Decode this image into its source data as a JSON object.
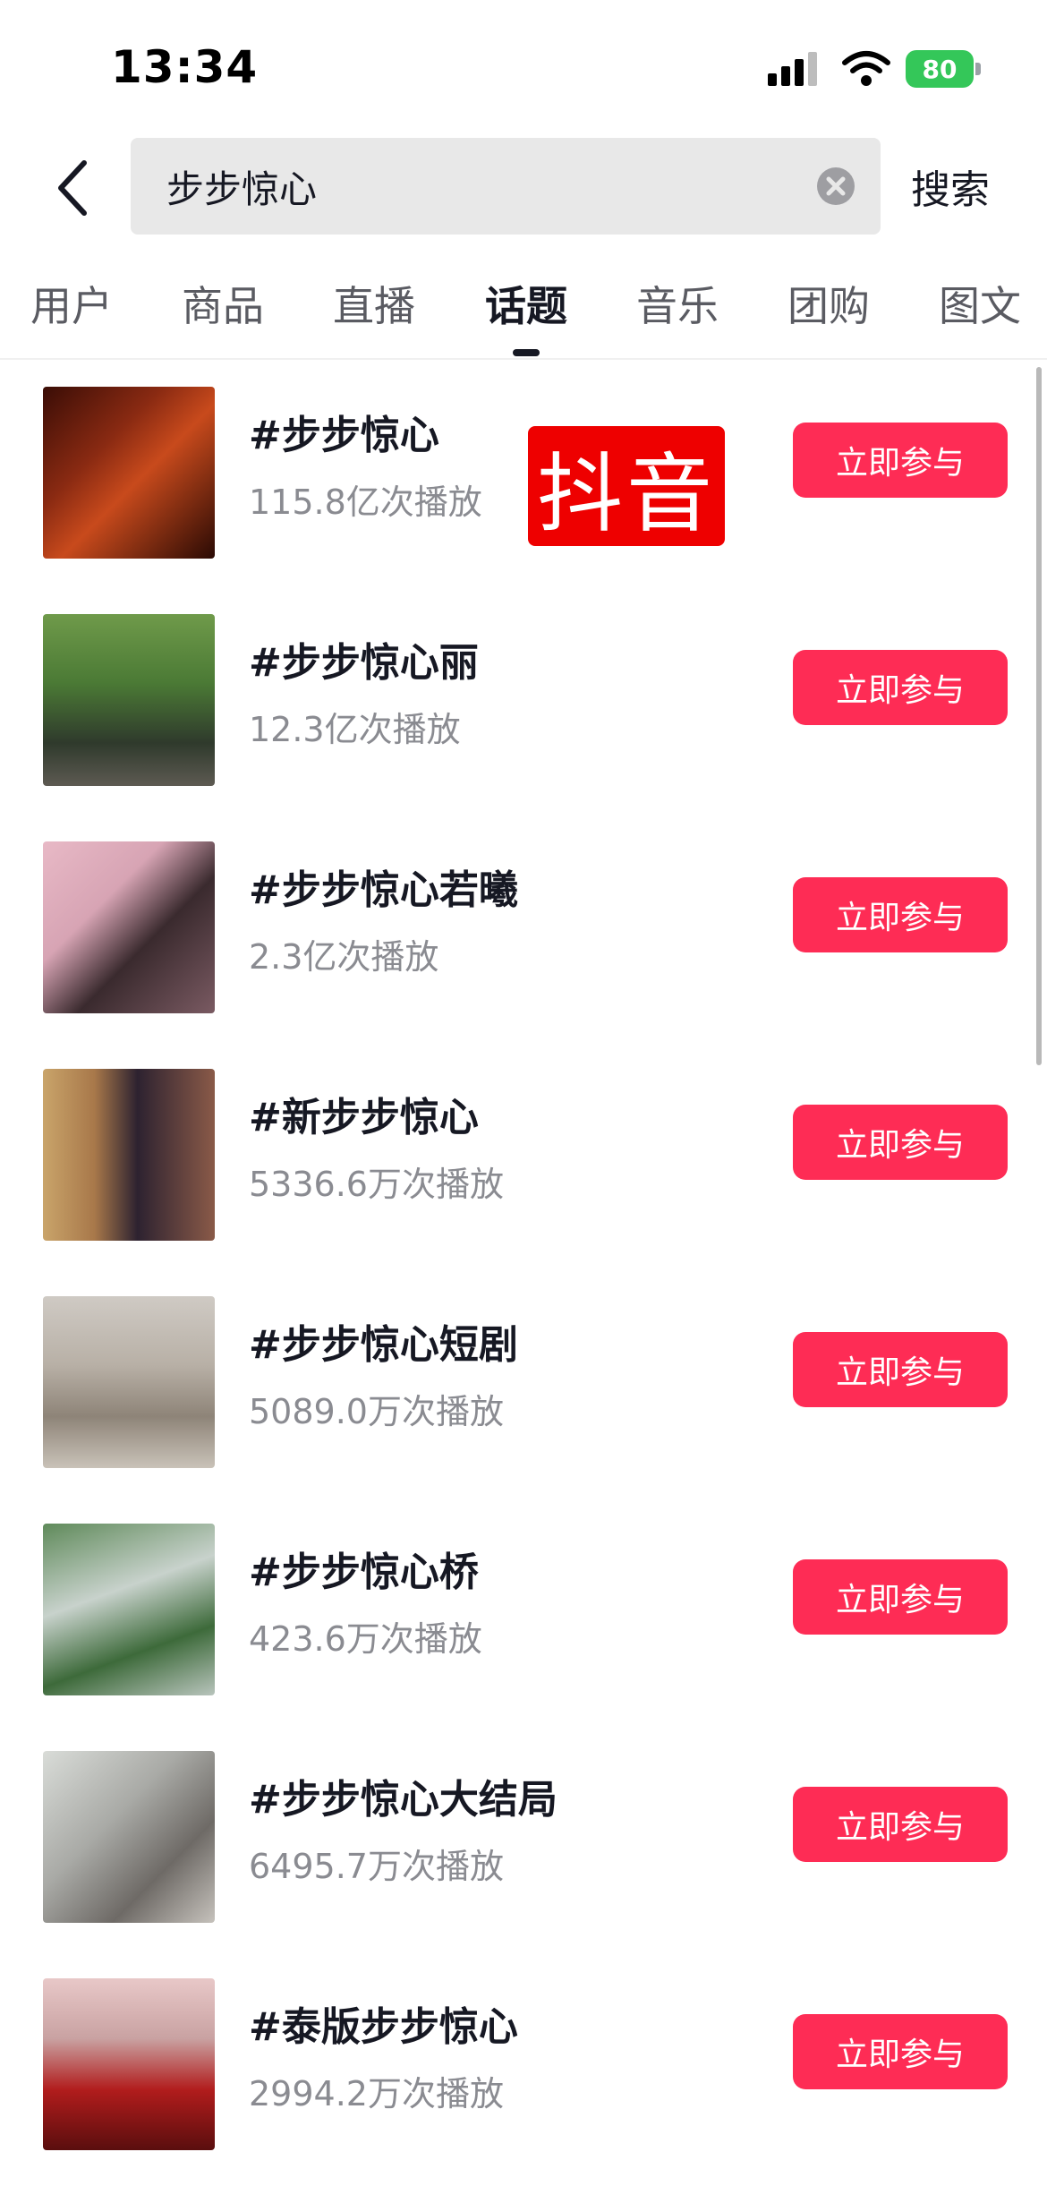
{
  "status_bar": {
    "time": "13:34",
    "battery_level": "80"
  },
  "search": {
    "query": "步步惊心",
    "button_label": "搜索"
  },
  "tabs": [
    {
      "label": "用户",
      "active": false
    },
    {
      "label": "商品",
      "active": false
    },
    {
      "label": "直播",
      "active": false
    },
    {
      "label": "话题",
      "active": true
    },
    {
      "label": "音乐",
      "active": false
    },
    {
      "label": "团购",
      "active": false
    },
    {
      "label": "图文",
      "active": false
    }
  ],
  "watermark": "抖音",
  "topics": [
    {
      "title": "#步步惊心",
      "plays": "115.8亿次播放",
      "button": "立即参与"
    },
    {
      "title": "#步步惊心丽",
      "plays": "12.3亿次播放",
      "button": "立即参与"
    },
    {
      "title": "#步步惊心若曦",
      "plays": "2.3亿次播放",
      "button": "立即参与"
    },
    {
      "title": "#新步步惊心",
      "plays": "5336.6万次播放",
      "button": "立即参与"
    },
    {
      "title": "#步步惊心短剧",
      "plays": "5089.0万次播放",
      "button": "立即参与"
    },
    {
      "title": "#步步惊心桥",
      "plays": "423.6万次播放",
      "button": "立即参与"
    },
    {
      "title": "#步步惊心大结局",
      "plays": "6495.7万次播放",
      "button": "立即参与"
    },
    {
      "title": "#泰版步步惊心",
      "plays": "2994.2万次播放",
      "button": "立即参与"
    }
  ],
  "colors": {
    "accent": "#fe2c55",
    "battery": "#34c759",
    "logo": "#ee0000"
  }
}
